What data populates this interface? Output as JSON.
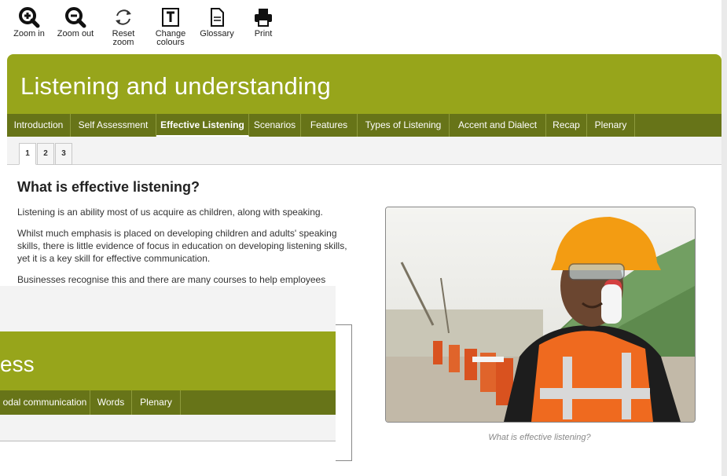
{
  "toolbar": {
    "items": [
      {
        "label": "Zoom in",
        "icon": "zoom-in-icon"
      },
      {
        "label": "Zoom out",
        "icon": "zoom-out-icon"
      },
      {
        "label": "Reset zoom",
        "icon": "reset-zoom-icon"
      },
      {
        "label": "Change colours",
        "icon": "change-colours-icon"
      },
      {
        "label": "Glossary",
        "icon": "glossary-icon"
      },
      {
        "label": "Print",
        "icon": "print-icon"
      }
    ]
  },
  "page": {
    "title": "Listening and understanding",
    "nav": [
      "Introduction",
      "Self Assessment",
      "Effective Listening",
      "Scenarios",
      "Features",
      "Types of Listening",
      "Accent and Dialect",
      "Recap",
      "Plenary"
    ],
    "active_nav": "Effective Listening",
    "pages": [
      "1",
      "2",
      "3"
    ],
    "active_page": "1"
  },
  "content": {
    "heading": "What is effective listening?",
    "paragraphs": [
      "Listening is an ability most of us acquire as children, along with speaking.",
      "Whilst much emphasis is placed on developing children and adults' speaking skills, there is little evidence of focus in education on developing listening skills, yet it is a key skill for effective communication.",
      "Businesses recognise this and there are many courses to help employees"
    ],
    "image_caption": "What is effective listening?"
  },
  "overlay": {
    "title_fragment": "ess",
    "nav": [
      "odal communication",
      "Words",
      "Plenary"
    ]
  },
  "colors": {
    "banner": "#97a51b",
    "nav": "#677418"
  }
}
